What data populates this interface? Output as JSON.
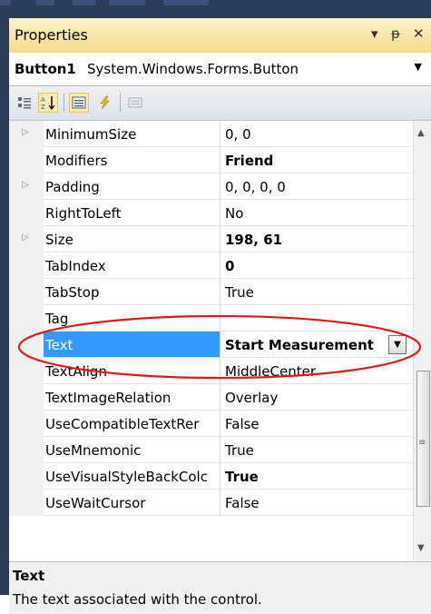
{
  "window": {
    "title": "Properties",
    "dropdown_glyph": "▾",
    "pin_glyph": "ᵽ",
    "close_glyph": "✕"
  },
  "object_selector": {
    "name": "Button1",
    "type": "System.Windows.Forms.Button"
  },
  "toolbar": {
    "buttons": [
      "categorized",
      "alphabetical",
      "properties",
      "events",
      "property-pages"
    ],
    "active": [
      "alphabetical",
      "properties"
    ]
  },
  "properties": [
    {
      "name": "MinimumSize",
      "value": "0, 0",
      "expandable": true,
      "bold": false
    },
    {
      "name": "Modifiers",
      "value": "Friend",
      "expandable": false,
      "bold": true
    },
    {
      "name": "Padding",
      "value": "0, 0, 0, 0",
      "expandable": true,
      "bold": false
    },
    {
      "name": "RightToLeft",
      "value": "No",
      "expandable": false,
      "bold": false
    },
    {
      "name": "Size",
      "value": "198, 61",
      "expandable": true,
      "bold": true
    },
    {
      "name": "TabIndex",
      "value": "0",
      "expandable": false,
      "bold": true
    },
    {
      "name": "TabStop",
      "value": "True",
      "expandable": false,
      "bold": false
    },
    {
      "name": "Tag",
      "value": "",
      "expandable": false,
      "bold": false
    },
    {
      "name": "Text",
      "value": "Start Measurement",
      "expandable": false,
      "bold": true,
      "selected": true
    },
    {
      "name": "TextAlign",
      "value": "MiddleCenter",
      "expandable": false,
      "bold": false
    },
    {
      "name": "TextImageRelation",
      "value": "Overlay",
      "expandable": false,
      "bold": false
    },
    {
      "name": "UseCompatibleTextRer",
      "value": "False",
      "expandable": false,
      "bold": false
    },
    {
      "name": "UseMnemonic",
      "value": "True",
      "expandable": false,
      "bold": false
    },
    {
      "name": "UseVisualStyleBackColc",
      "value": "True",
      "expandable": false,
      "bold": true
    },
    {
      "name": "UseWaitCursor",
      "value": "False",
      "expandable": false,
      "bold": false
    }
  ],
  "description": {
    "title": "Text",
    "text": "The text associated with the control."
  },
  "colors": {
    "selection": "#3399ff",
    "annotation": "#e0181b"
  }
}
